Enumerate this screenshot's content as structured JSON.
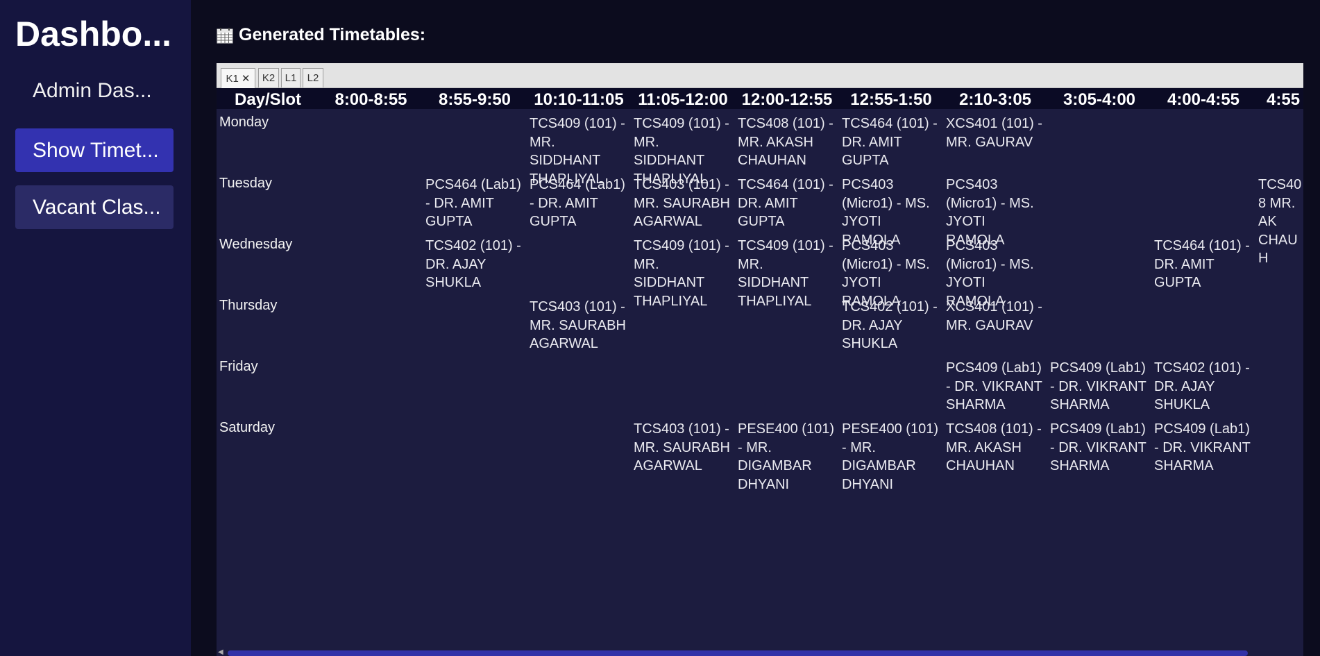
{
  "sidebar": {
    "title": "Dashbo...",
    "link": "Admin Das...",
    "buttons": [
      "Show Timet...",
      "Vacant Clas..."
    ]
  },
  "main": {
    "heading": "Generated Timetables:",
    "heading_icon": "calendar-icon"
  },
  "tabs": [
    {
      "label": "K1",
      "active": true,
      "closable": true
    },
    {
      "label": "K2",
      "active": false
    },
    {
      "label": "L1",
      "active": false
    },
    {
      "label": "L2",
      "active": false
    }
  ],
  "timetable": {
    "headers": [
      "Day/Slot",
      "8:00-8:55",
      "8:55-9:50",
      "10:10-11:05",
      "11:05-12:00",
      "12:00-12:55",
      "12:55-1:50",
      "2:10-3:05",
      "3:05-4:00",
      "4:00-4:55",
      "4:55"
    ],
    "rows": [
      {
        "day": "Monday",
        "cells": [
          "",
          "",
          "TCS409 (101) - MR. SIDDHANT THAPLIYAL",
          "TCS409 (101) - MR. SIDDHANT THAPLIYAL",
          "TCS408 (101) - MR. AKASH CHAUHAN",
          "TCS464 (101) - DR. AMIT GUPTA",
          "XCS401 (101) - MR. GAURAV",
          "",
          "",
          ""
        ]
      },
      {
        "day": "Tuesday",
        "cells": [
          "",
          "PCS464 (Lab1) - DR. AMIT GUPTA",
          "PCS464 (Lab1) - DR. AMIT GUPTA",
          "TCS403 (101) - MR. SAURABH AGARWAL",
          "TCS464 (101) - DR. AMIT GUPTA",
          "PCS403 (Micro1) - MS. JYOTI RAMOLA",
          "PCS403 (Micro1) - MS. JYOTI RAMOLA",
          "",
          "",
          "TCS408 MR. AK CHAUH"
        ]
      },
      {
        "day": "Wednesday",
        "cells": [
          "",
          "TCS402 (101) - DR. AJAY SHUKLA",
          "",
          "TCS409 (101) - MR. SIDDHANT THAPLIYAL",
          "TCS409 (101) - MR. SIDDHANT THAPLIYAL",
          "PCS403 (Micro1) - MS. JYOTI RAMOLA",
          "PCS403 (Micro1) - MS. JYOTI RAMOLA",
          "",
          "TCS464 (101) - DR. AMIT GUPTA",
          ""
        ]
      },
      {
        "day": "Thursday",
        "cells": [
          "",
          "",
          "TCS403 (101) - MR. SAURABH AGARWAL",
          "",
          "",
          "TCS402 (101) - DR. AJAY SHUKLA",
          "XCS401 (101) - MR. GAURAV",
          "",
          "",
          ""
        ]
      },
      {
        "day": "Friday",
        "cells": [
          "",
          "",
          "",
          "",
          "",
          "",
          "PCS409 (Lab1) - DR. VIKRANT SHARMA",
          "PCS409 (Lab1) - DR. VIKRANT SHARMA",
          "TCS402 (101) - DR. AJAY SHUKLA",
          ""
        ]
      },
      {
        "day": "Saturday",
        "cells": [
          "",
          "",
          "",
          "TCS403 (101) - MR. SAURABH AGARWAL",
          "PESE400 (101) - MR. DIGAMBAR DHYANI",
          "PESE400 (101) - MR. DIGAMBAR DHYANI",
          "TCS408 (101) - MR. AKASH CHAUHAN",
          "PCS409 (Lab1) - DR. VIKRANT SHARMA",
          "PCS409 (Lab1) - DR. VIKRANT SHARMA",
          ""
        ]
      }
    ]
  },
  "colors": {
    "sidebar_bg": "#15153f",
    "page_bg": "#0c0c1e",
    "panel_bg": "#1c1c3f",
    "primary_button": "#3332b0",
    "secondary_button": "#2b2b66"
  }
}
